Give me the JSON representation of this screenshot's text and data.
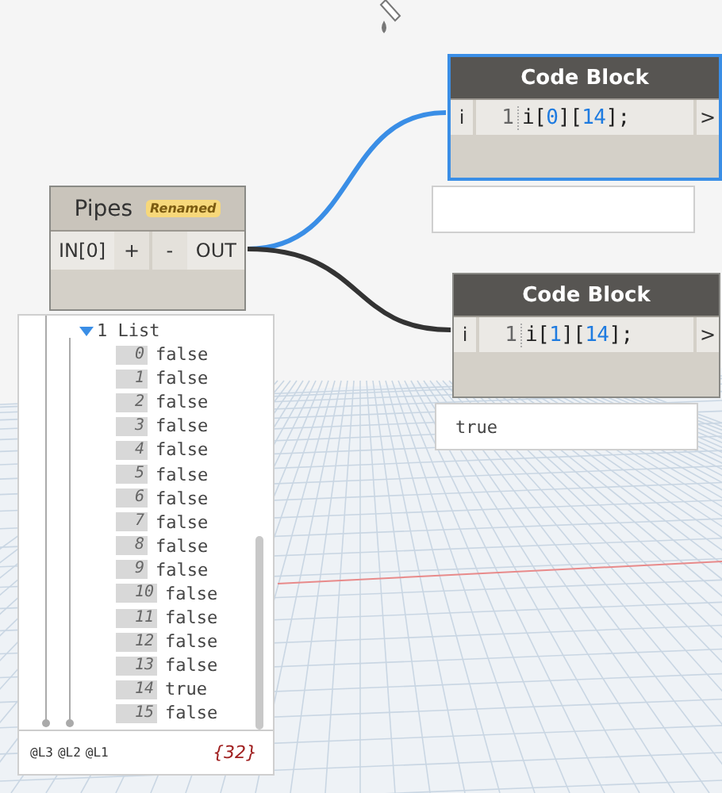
{
  "pipes_node": {
    "title": "Pipes",
    "badge": "Renamed",
    "ports": [
      {
        "label": "IN[0]",
        "kind": "port"
      },
      {
        "label": "+",
        "kind": "button"
      },
      {
        "label": "-",
        "kind": "button"
      },
      {
        "label": "OUT",
        "kind": "port"
      }
    ]
  },
  "code_blocks": [
    {
      "title": "Code Block",
      "selected": true,
      "input": "i",
      "line_number": "1",
      "code": "i[0][14];",
      "output_port": ">"
    },
    {
      "title": "Code Block",
      "selected": false,
      "input": "i",
      "line_number": "1",
      "code": "i[1][14];",
      "output_port": ">",
      "preview": "true"
    }
  ],
  "watch": {
    "header": "1 List",
    "expanded": true,
    "rows": [
      {
        "index": "0",
        "value": "false"
      },
      {
        "index": "1",
        "value": "false"
      },
      {
        "index": "2",
        "value": "false"
      },
      {
        "index": "3",
        "value": "false"
      },
      {
        "index": "4",
        "value": "false"
      },
      {
        "index": "5",
        "value": "false"
      },
      {
        "index": "6",
        "value": "false"
      },
      {
        "index": "7",
        "value": "false"
      },
      {
        "index": "8",
        "value": "false"
      },
      {
        "index": "9",
        "value": "false"
      },
      {
        "index": "10",
        "value": "false"
      },
      {
        "index": "11",
        "value": "false"
      },
      {
        "index": "12",
        "value": "false"
      },
      {
        "index": "13",
        "value": "false"
      },
      {
        "index": "14",
        "value": "true"
      },
      {
        "index": "15",
        "value": "false"
      }
    ],
    "levels": [
      "@L3",
      "@L2",
      "@L1"
    ],
    "count": "{32}"
  }
}
